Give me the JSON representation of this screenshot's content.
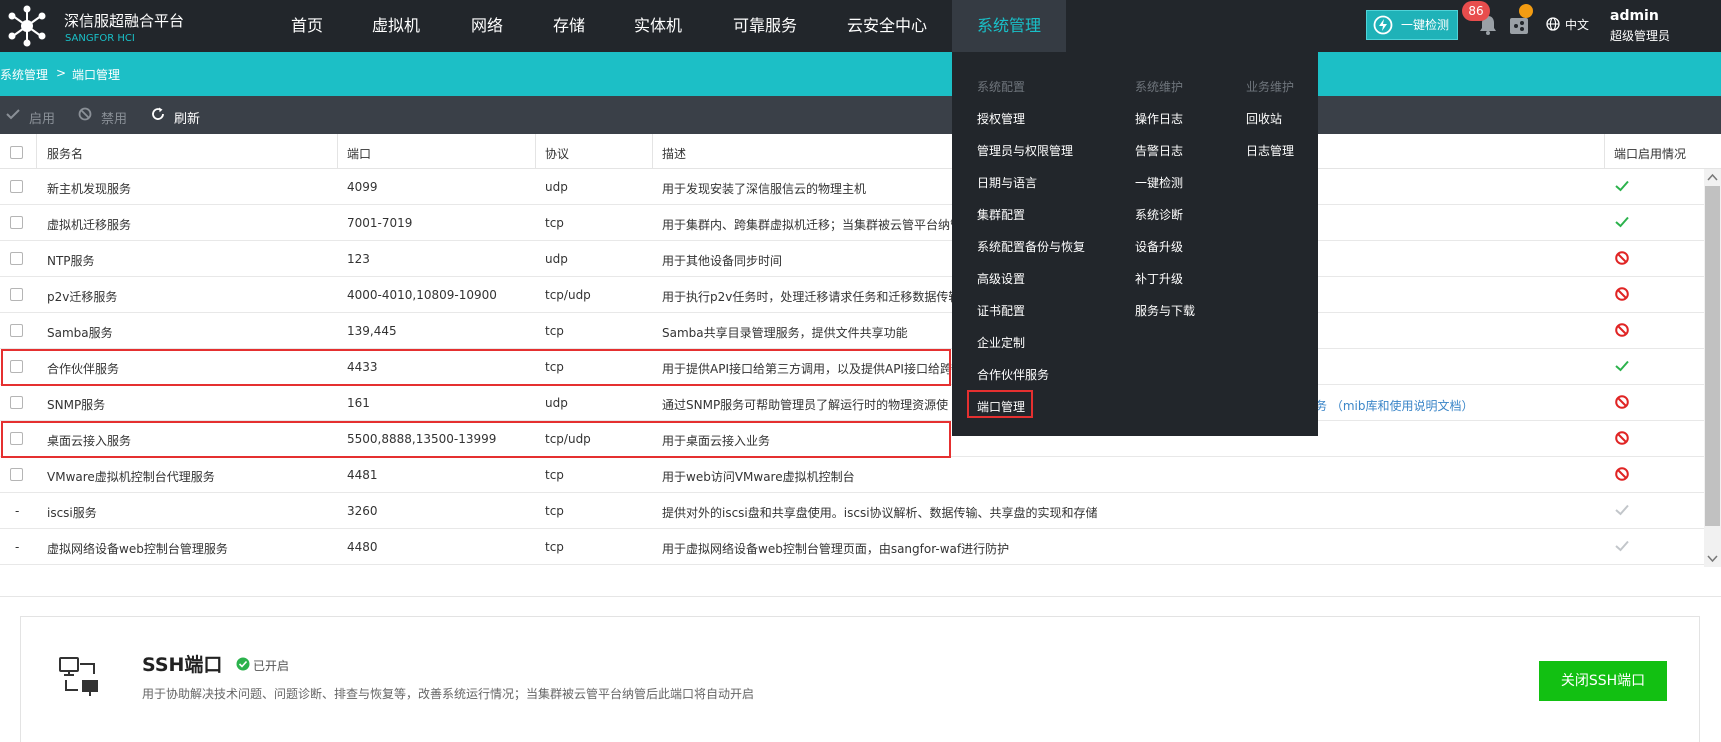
{
  "app": {
    "title": "深信服超融合平台",
    "subtitle": "SANGFOR HCI"
  },
  "nav": {
    "items": [
      "首页",
      "虚拟机",
      "网络",
      "存储",
      "实体机",
      "可靠服务",
      "云安全中心",
      "系统管理"
    ],
    "active": "系统管理"
  },
  "header": {
    "check_label": "一键检测",
    "notification_count": "86",
    "language": "中文",
    "user_name": "admin",
    "user_role": "超级管理员"
  },
  "breadcrumb": {
    "parent": "系统管理",
    "separator": ">",
    "current": "端口管理"
  },
  "toolbar": {
    "enable": "启用",
    "disable": "禁用",
    "refresh": "刷新"
  },
  "table": {
    "columns": [
      "服务名",
      "端口",
      "协议",
      "描述",
      "端口启用情况"
    ],
    "rows": [
      {
        "name": "新主机发现服务",
        "port": "4099",
        "protocol": "udp",
        "desc": "用于发现安装了深信服信云的物理主机",
        "status": "enabled",
        "selectable": true
      },
      {
        "name": "虚拟机迁移服务",
        "port": "7001-7019",
        "protocol": "tcp",
        "desc": "用于集群内、跨集群虚拟机迁移；当集群被云管平台纳管",
        "status": "enabled",
        "selectable": true
      },
      {
        "name": "NTP服务",
        "port": "123",
        "protocol": "udp",
        "desc": "用于其他设备同步时间",
        "status": "disabled",
        "selectable": true
      },
      {
        "name": "p2v迁移服务",
        "port": "4000-4010,10809-10900",
        "protocol": "tcp/udp",
        "desc": "用于执行p2v任务时，处理迁移请求任务和迁移数据传输",
        "status": "disabled",
        "selectable": true
      },
      {
        "name": "Samba服务",
        "port": "139,445",
        "protocol": "tcp",
        "desc": "Samba共享目录管理服务，提供文件共享功能",
        "status": "disabled",
        "selectable": true
      },
      {
        "name": "合作伙伴服务",
        "port": "4433",
        "protocol": "tcp",
        "desc": "用于提供API接口给第三方调用，以及提供API接口给跨",
        "status": "enabled",
        "selectable": true
      },
      {
        "name": "SNMP服务",
        "port": "161",
        "protocol": "udp",
        "desc": "通过SNMP服务可帮助管理员了解运行时的物理资源使",
        "status": "disabled",
        "selectable": true
      },
      {
        "name": "桌面云接入服务",
        "port": "5500,8888,13500-13999",
        "protocol": "tcp/udp",
        "desc": "用于桌面云接入业务",
        "status": "disabled",
        "selectable": true
      },
      {
        "name": "VMware虚拟机控制台代理服务",
        "port": "4481",
        "protocol": "tcp",
        "desc": "用于web访问VMware虚拟机控制台",
        "status": "disabled",
        "selectable": true
      },
      {
        "name": "iscsi服务",
        "port": "3260",
        "protocol": "tcp",
        "desc": "提供对外的iscsi盘和共享盘使用。iscsi协议解析、数据传输、共享盘的实现和存储",
        "status": "fixed",
        "selectable": false
      },
      {
        "name": "虚拟网络设备web控制台管理服务",
        "port": "4480",
        "protocol": "tcp",
        "desc": "用于虚拟网络设备web控制台管理页面，由sangfor-waf进行防护",
        "status": "fixed",
        "selectable": false
      }
    ],
    "snmp_link": "（mib库和使用说明文档）",
    "snmp_link_prefix": "务",
    "row_dash": "-"
  },
  "dropdown": {
    "columns": [
      {
        "heading": "系统配置",
        "items": [
          "授权管理",
          "管理员与权限管理",
          "日期与语言",
          "集群配置",
          "系统配置备份与恢复",
          "高级设置",
          "证书配置",
          "企业定制",
          "合作伙伴服务",
          "端口管理"
        ]
      },
      {
        "heading": "系统维护",
        "items": [
          "操作日志",
          "告警日志",
          "一键检测",
          "系统诊断",
          "设备升级",
          "补丁升级",
          "服务与下载"
        ]
      },
      {
        "heading": "业务维护",
        "items": [
          "回收站",
          "日志管理"
        ]
      }
    ]
  },
  "ssh": {
    "title": "SSH端口",
    "status": "已开启",
    "description": "用于协助解决技术问题、问题诊断、排查与恢复等，改善系统运行情况；当集群被云管平台纳管后此端口将自动开启",
    "button": "关闭SSH端口"
  },
  "colors": {
    "topbar": "#22262b",
    "accent": "#1cbfc6",
    "toolbar": "#3a4048",
    "ok": "#2bb24c",
    "deny": "#e02424",
    "highlight": "#e53030",
    "ssh_button": "#12c012"
  }
}
